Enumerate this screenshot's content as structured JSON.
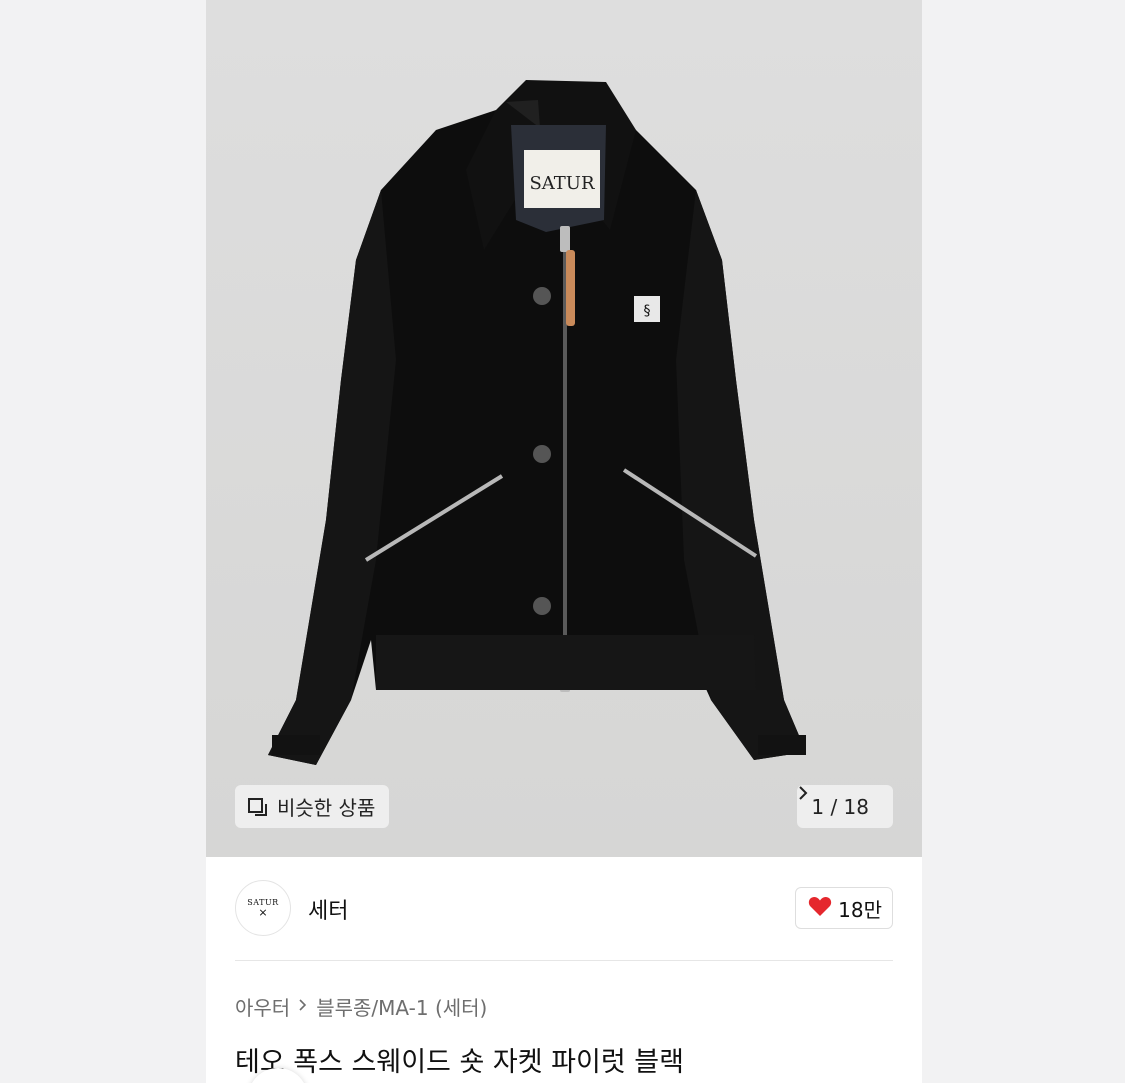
{
  "colors": {
    "page_bg": "#f2f2f3",
    "hero_bg": "#dcdcdb",
    "heart": "#e5272d",
    "text_primary": "#111111",
    "text_secondary": "#6e6e6e"
  },
  "hero": {
    "image_label": "SATUR",
    "similar_button": {
      "icon": "similar-items-icon",
      "label": "비슷한 상품"
    },
    "counter": {
      "text": "1 / 18",
      "icon": "chevron-right-icon"
    }
  },
  "brand": {
    "logo_text": "SATUR",
    "name": "세터",
    "likes": {
      "icon": "heart-icon",
      "count": "18만"
    }
  },
  "breadcrumb": {
    "items": [
      "아우터",
      "블루종/MA-1 (세터)"
    ],
    "separator_icon": "chevron-right-icon"
  },
  "product": {
    "title": "테오 폭스 스웨이드 숏 자켓 파이럿 블랙"
  }
}
